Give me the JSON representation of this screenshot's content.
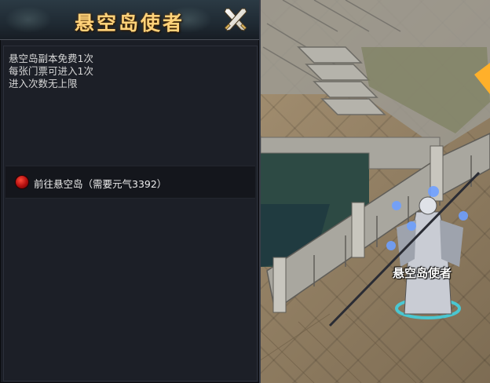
{
  "dialog": {
    "title": "悬空岛使者",
    "close_icon": "close-x-icon",
    "info_lines": [
      "悬空岛副本免费1次",
      "每张门票可进入1次",
      "进入次数无上限"
    ],
    "option": {
      "bullet_icon": "red-orb-icon",
      "label": "前往悬空岛（需要元气3392）"
    }
  },
  "world": {
    "npc_name": "悬空岛使者"
  },
  "colors": {
    "title": "#ffd27a",
    "text": "#d8d8d8",
    "panel_bg": "#1b1e26",
    "bullet": "#c01010"
  }
}
